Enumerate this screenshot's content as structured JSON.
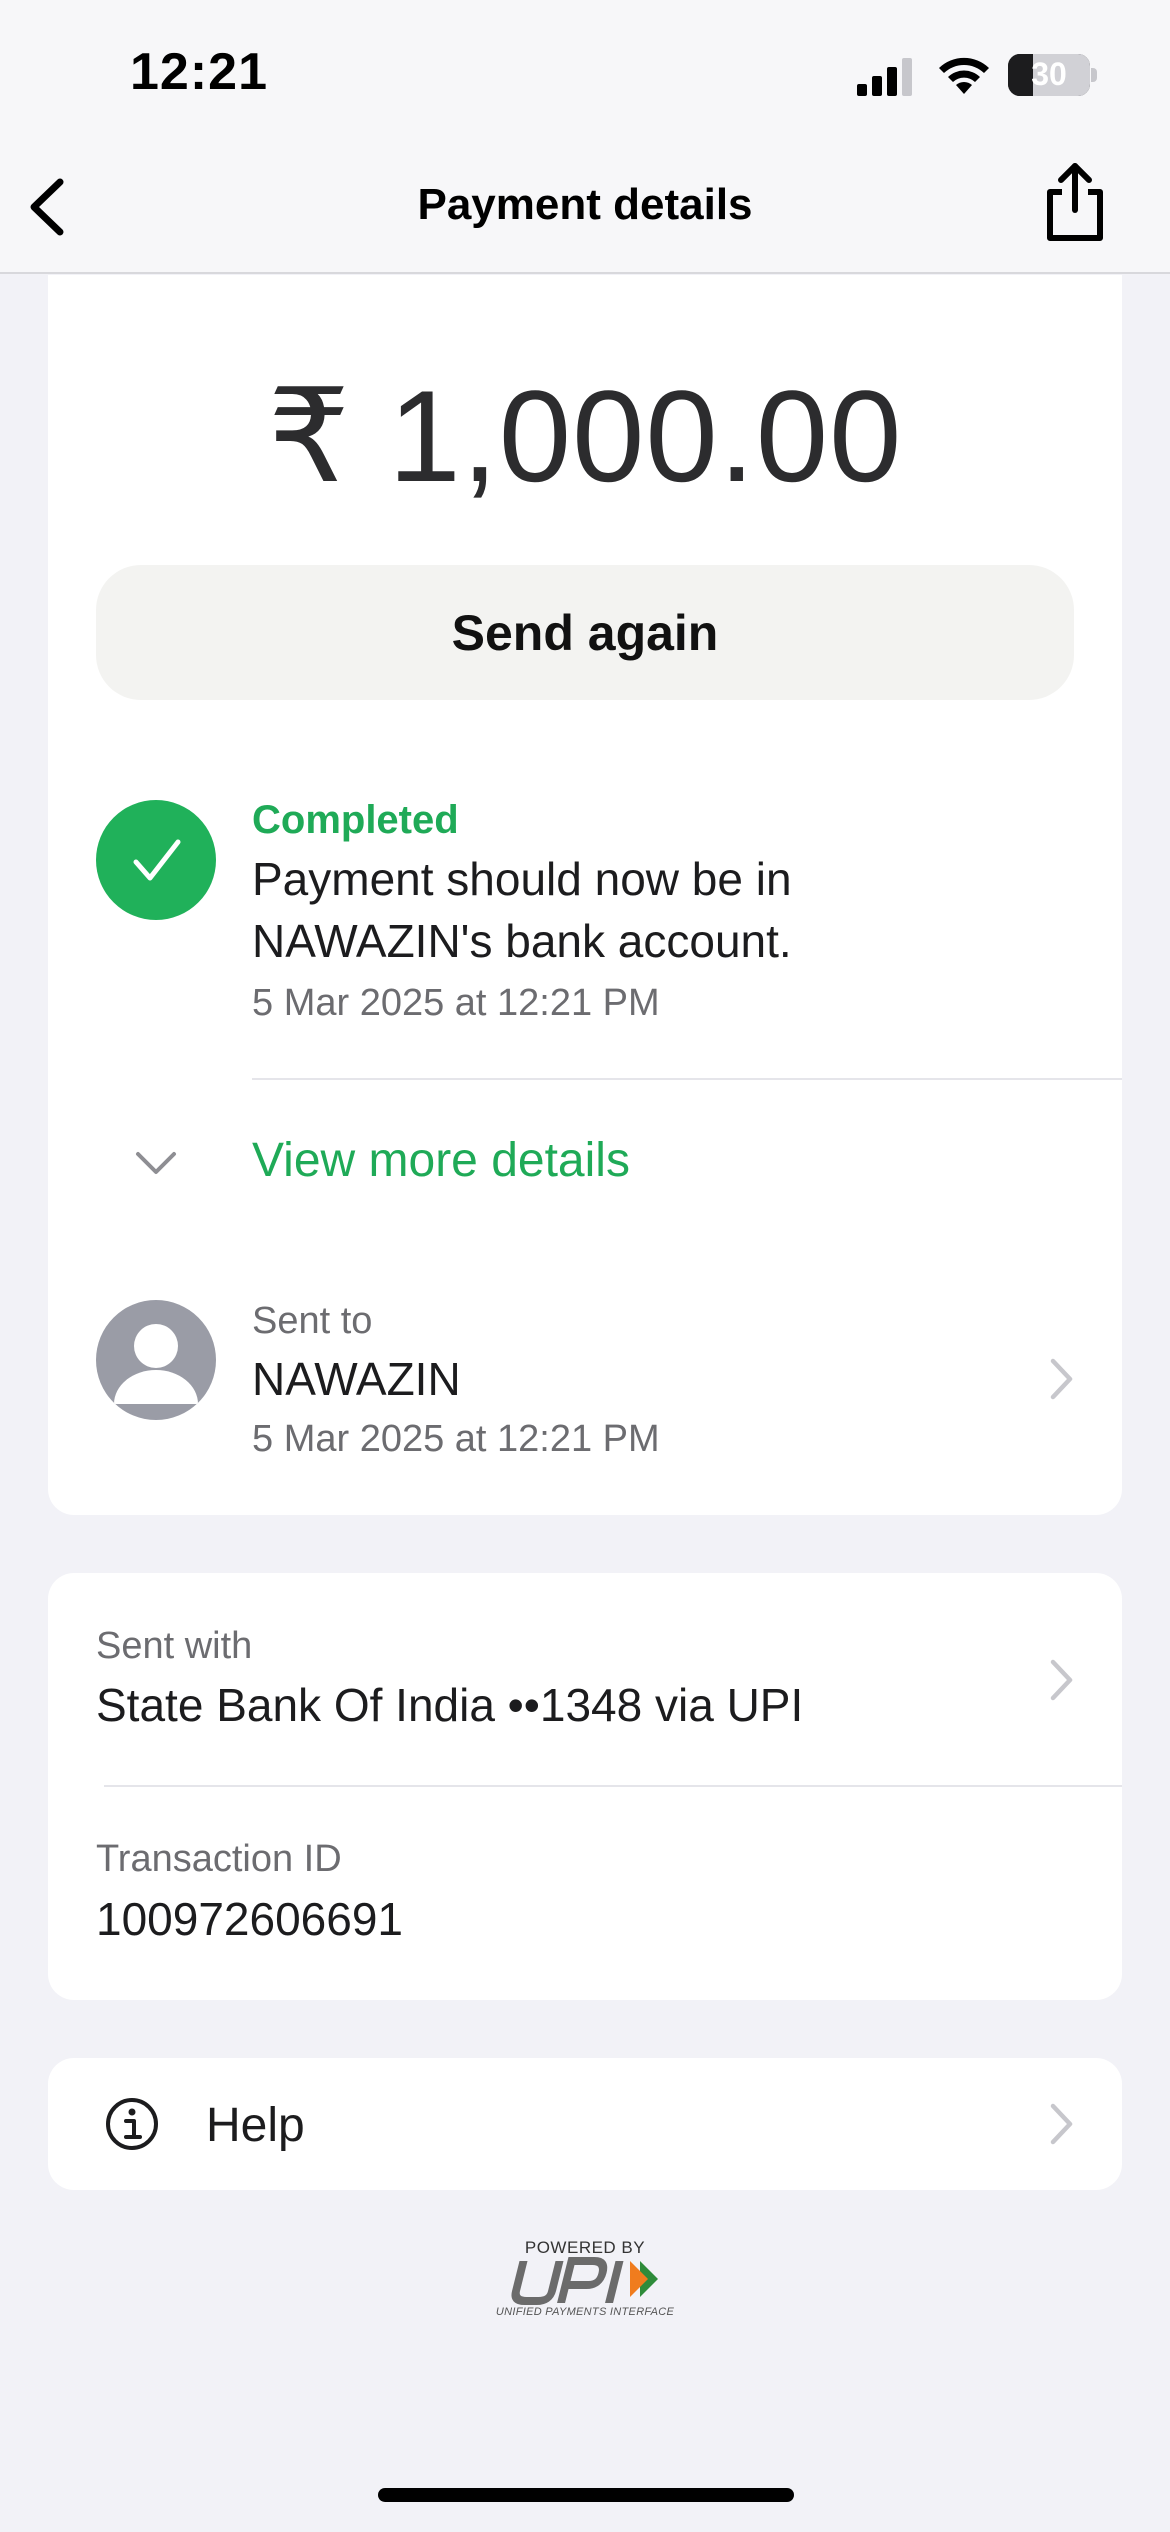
{
  "status_bar": {
    "time": "12:21",
    "battery_percent": "30",
    "battery_level": 0.3,
    "icons": [
      "cellular-signal-icon",
      "wifi-icon",
      "battery-icon"
    ]
  },
  "nav": {
    "title": "Payment details",
    "back_icon": "chevron-left-icon",
    "share_icon": "share-icon"
  },
  "payment": {
    "amount": "₹ 1,000.00",
    "send_again_label": "Send again",
    "status": "Completed",
    "message_line1": "Payment should now be in",
    "message_line2": "NAWAZIN's bank account.",
    "date": "5 Mar 2025 at 12:21 PM",
    "view_more_label": "View more details"
  },
  "recipient": {
    "label": "Sent to",
    "name": "NAWAZIN",
    "date": "5 Mar 2025 at 12:21 PM"
  },
  "source": {
    "label": "Sent with",
    "bank": "State Bank Of India ••1348 via UPI",
    "txn_label": "Transaction ID",
    "txn_id": "100972606691"
  },
  "help": {
    "label": "Help"
  },
  "footer": {
    "powered_by": "POWERED BY",
    "tagline": "UNIFIED PAYMENTS INTERFACE"
  },
  "colors": {
    "accent_green": "#1faa57",
    "background": "#f2f2f7"
  }
}
